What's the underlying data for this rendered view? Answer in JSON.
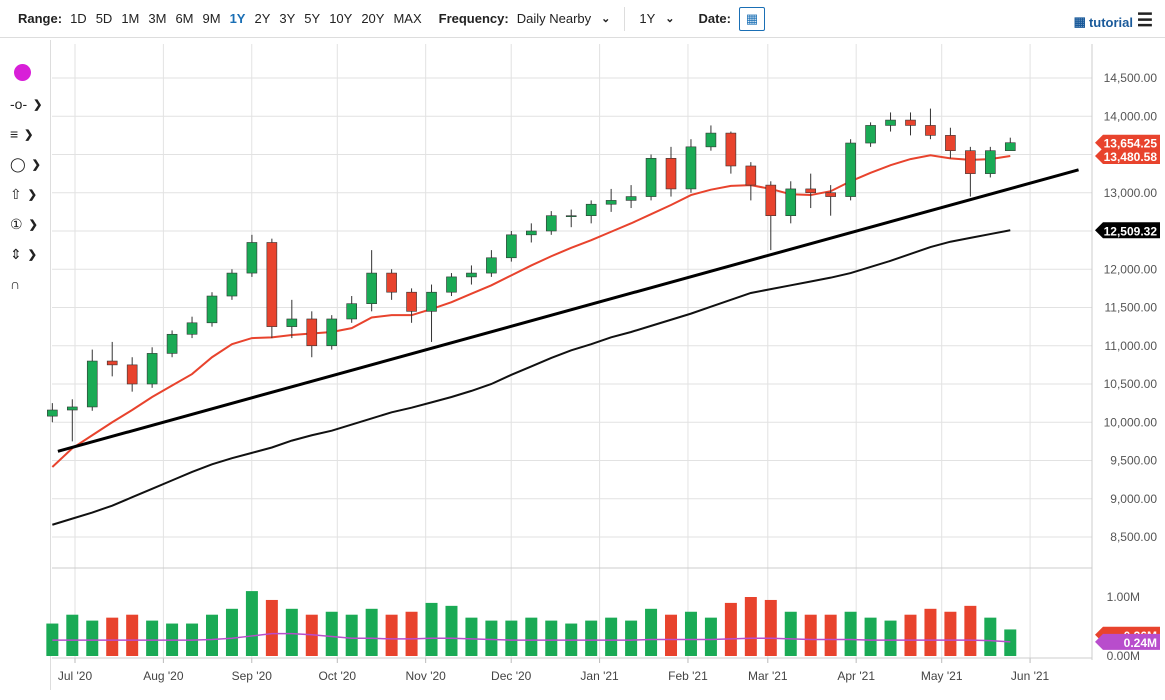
{
  "toolbar": {
    "range_label": "Range:",
    "ranges": [
      "1D",
      "5D",
      "1M",
      "3M",
      "6M",
      "9M",
      "1Y",
      "2Y",
      "3Y",
      "5Y",
      "10Y",
      "20Y",
      "MAX"
    ],
    "active_range": "1Y",
    "frequency_label": "Frequency:",
    "frequency_value": "Daily Nearby",
    "period_value": "1Y",
    "date_label": "Date:",
    "tutorial_label": "tutorial"
  },
  "tools": [
    "color-dot",
    "line-tool",
    "fib-tool",
    "shape-tool",
    "arrow-tool",
    "label-tool",
    "measure-tool",
    "magnet-tool"
  ],
  "colors": {
    "up": "#1aaa55",
    "down": "#e8432d",
    "ma50": "#e8432d",
    "ma200": "#111111",
    "vol_ma": "#b84dcc",
    "accent": "#1a6fb5",
    "dot": "#d81fd8"
  },
  "chart_data": {
    "type": "candlestick",
    "start_date": "2020-06-22",
    "interval_days": 7,
    "first_open": 10080,
    "close": [
      10160,
      10200,
      10800,
      10750,
      10500,
      10900,
      11150,
      11300,
      11650,
      11950,
      12350,
      11250,
      11350,
      11000,
      11350,
      11550,
      11950,
      11700,
      11450,
      11700,
      11900,
      11950,
      12150,
      12450,
      12500,
      12700,
      12700,
      12850,
      12900,
      12950,
      13450,
      13050,
      13600,
      13780,
      13350,
      13100,
      12700,
      13050,
      13000,
      12950,
      13650,
      13880,
      13950,
      13880,
      13750,
      13550,
      13250,
      13550,
      13654
    ],
    "high": [
      10250,
      10300,
      10950,
      11050,
      10850,
      10980,
      11200,
      11380,
      11700,
      12000,
      12450,
      12400,
      11600,
      11450,
      11400,
      11650,
      12250,
      12000,
      11750,
      11800,
      11950,
      12050,
      12250,
      12500,
      12600,
      12760,
      12780,
      12900,
      13050,
      13100,
      13500,
      13600,
      13700,
      13880,
      13800,
      13400,
      13150,
      13150,
      13250,
      13100,
      13700,
      13920,
      14050,
      14050,
      14100,
      13850,
      13600,
      13600,
      13720
    ],
    "low": [
      10000,
      9750,
      10150,
      10600,
      10400,
      10450,
      10850,
      11100,
      11250,
      11600,
      11900,
      11100,
      11100,
      10850,
      10950,
      11300,
      11450,
      11600,
      11300,
      11050,
      11650,
      11800,
      11900,
      12100,
      12350,
      12450,
      12550,
      12600,
      12750,
      12800,
      12900,
      12950,
      13000,
      13550,
      13250,
      12900,
      12250,
      12600,
      12800,
      12700,
      12900,
      13600,
      13800,
      13750,
      13700,
      13450,
      12950,
      13200,
      13580
    ],
    "ma50": [
      9415,
      9660,
      9830,
      10000,
      10160,
      10330,
      10480,
      10630,
      10850,
      11020,
      11100,
      11110,
      11140,
      11160,
      11180,
      11230,
      11370,
      11400,
      11400,
      11480,
      11570,
      11680,
      11790,
      11920,
      12050,
      12170,
      12280,
      12380,
      12490,
      12600,
      12720,
      12840,
      12970,
      13040,
      13090,
      13100,
      13050,
      12980,
      12970,
      13020,
      13150,
      13260,
      13360,
      13440,
      13490,
      13450,
      13430,
      13440,
      13480
    ],
    "ma200": [
      8660,
      8740,
      8820,
      8910,
      9020,
      9130,
      9240,
      9350,
      9450,
      9530,
      9600,
      9670,
      9760,
      9830,
      9890,
      9970,
      10050,
      10130,
      10190,
      10260,
      10330,
      10410,
      10500,
      10620,
      10730,
      10840,
      10940,
      11020,
      11110,
      11180,
      11260,
      11340,
      11420,
      11510,
      11600,
      11690,
      11740,
      11790,
      11840,
      11890,
      11950,
      12030,
      12110,
      12200,
      12290,
      12360,
      12410,
      12460,
      12510
    ],
    "volume_m": [
      0.55,
      0.7,
      0.6,
      0.65,
      0.7,
      0.6,
      0.55,
      0.55,
      0.7,
      0.8,
      1.1,
      0.95,
      0.8,
      0.7,
      0.75,
      0.7,
      0.8,
      0.7,
      0.75,
      0.9,
      0.85,
      0.65,
      0.6,
      0.6,
      0.65,
      0.6,
      0.55,
      0.6,
      0.65,
      0.6,
      0.8,
      0.7,
      0.75,
      0.65,
      0.9,
      1.0,
      0.95,
      0.75,
      0.7,
      0.7,
      0.75,
      0.65,
      0.6,
      0.7,
      0.8,
      0.75,
      0.85,
      0.65,
      0.45
    ],
    "volume_ma_m": [
      0.27,
      0.27,
      0.27,
      0.27,
      0.27,
      0.27,
      0.27,
      0.27,
      0.28,
      0.3,
      0.34,
      0.38,
      0.38,
      0.36,
      0.33,
      0.3,
      0.3,
      0.29,
      0.29,
      0.3,
      0.3,
      0.29,
      0.28,
      0.27,
      0.27,
      0.27,
      0.27,
      0.27,
      0.27,
      0.27,
      0.28,
      0.28,
      0.28,
      0.28,
      0.29,
      0.3,
      0.3,
      0.29,
      0.28,
      0.28,
      0.28,
      0.27,
      0.27,
      0.27,
      0.27,
      0.27,
      0.27,
      0.26,
      0.24
    ],
    "trendline": {
      "from": [
        "2020-06-25",
        9620
      ],
      "to": [
        "2021-06-18",
        13300
      ]
    },
    "y_ticks": [
      "14,500.00",
      "14,000.00",
      "13,500.00",
      "13,000.00",
      "12,500.00",
      "12,000.00",
      "11,500.00",
      "11,000.00",
      "10,500.00",
      "10,000.00",
      "9,500.00",
      "9,000.00",
      "8,500.00"
    ],
    "y_tick_values": [
      14500,
      14000,
      13500,
      13000,
      12500,
      12000,
      11500,
      11000,
      10500,
      10000,
      9500,
      9000,
      8500
    ],
    "ylim": [
      8300,
      14900
    ],
    "vol_ticks": [
      "1.00M",
      "0.00M"
    ],
    "x_ticks": [
      "Jul '20",
      "Aug '20",
      "Sep '20",
      "Oct '20",
      "Nov '20",
      "Dec '20",
      "Jan '21",
      "Feb '21",
      "Mar '21",
      "Apr '21",
      "May '21",
      "Jun '21"
    ],
    "x_tick_dates": [
      "2020-07-01",
      "2020-08-01",
      "2020-09-01",
      "2020-10-01",
      "2020-11-01",
      "2020-12-01",
      "2021-01-01",
      "2021-02-01",
      "2021-03-01",
      "2021-04-01",
      "2021-05-01",
      "2021-06-01"
    ],
    "tags": {
      "last": "13,654.25",
      "ma50": "13,480.58",
      "ma200": "12,509.32",
      "volume": "0.36M",
      "volume_ma": "0.24M"
    },
    "tag_values": {
      "last": 13654.25,
      "ma50": 13480.58,
      "ma200": 12509.32,
      "volume": 0.36,
      "volume_ma": 0.24
    }
  }
}
